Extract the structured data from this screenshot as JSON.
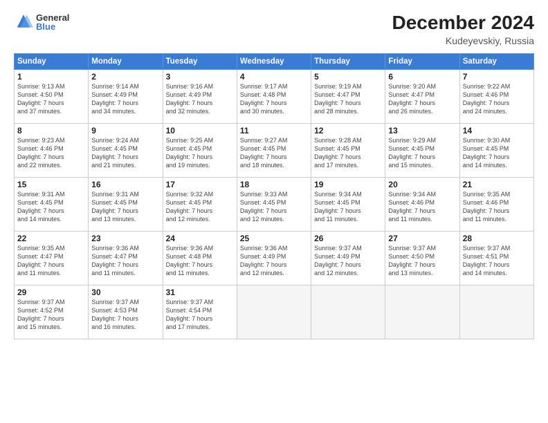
{
  "logo": {
    "general": "General",
    "blue": "Blue"
  },
  "title": "December 2024",
  "subtitle": "Kudeyevskiy, Russia",
  "headers": [
    "Sunday",
    "Monday",
    "Tuesday",
    "Wednesday",
    "Thursday",
    "Friday",
    "Saturday"
  ],
  "weeks": [
    [
      {
        "day": "1",
        "info": "Sunrise: 9:13 AM\nSunset: 4:50 PM\nDaylight: 7 hours\nand 37 minutes."
      },
      {
        "day": "2",
        "info": "Sunrise: 9:14 AM\nSunset: 4:49 PM\nDaylight: 7 hours\nand 34 minutes."
      },
      {
        "day": "3",
        "info": "Sunrise: 9:16 AM\nSunset: 4:49 PM\nDaylight: 7 hours\nand 32 minutes."
      },
      {
        "day": "4",
        "info": "Sunrise: 9:17 AM\nSunset: 4:48 PM\nDaylight: 7 hours\nand 30 minutes."
      },
      {
        "day": "5",
        "info": "Sunrise: 9:19 AM\nSunset: 4:47 PM\nDaylight: 7 hours\nand 28 minutes."
      },
      {
        "day": "6",
        "info": "Sunrise: 9:20 AM\nSunset: 4:47 PM\nDaylight: 7 hours\nand 26 minutes."
      },
      {
        "day": "7",
        "info": "Sunrise: 9:22 AM\nSunset: 4:46 PM\nDaylight: 7 hours\nand 24 minutes."
      }
    ],
    [
      {
        "day": "8",
        "info": "Sunrise: 9:23 AM\nSunset: 4:46 PM\nDaylight: 7 hours\nand 22 minutes."
      },
      {
        "day": "9",
        "info": "Sunrise: 9:24 AM\nSunset: 4:45 PM\nDaylight: 7 hours\nand 21 minutes."
      },
      {
        "day": "10",
        "info": "Sunrise: 9:25 AM\nSunset: 4:45 PM\nDaylight: 7 hours\nand 19 minutes."
      },
      {
        "day": "11",
        "info": "Sunrise: 9:27 AM\nSunset: 4:45 PM\nDaylight: 7 hours\nand 18 minutes."
      },
      {
        "day": "12",
        "info": "Sunrise: 9:28 AM\nSunset: 4:45 PM\nDaylight: 7 hours\nand 17 minutes."
      },
      {
        "day": "13",
        "info": "Sunrise: 9:29 AM\nSunset: 4:45 PM\nDaylight: 7 hours\nand 15 minutes."
      },
      {
        "day": "14",
        "info": "Sunrise: 9:30 AM\nSunset: 4:45 PM\nDaylight: 7 hours\nand 14 minutes."
      }
    ],
    [
      {
        "day": "15",
        "info": "Sunrise: 9:31 AM\nSunset: 4:45 PM\nDaylight: 7 hours\nand 14 minutes."
      },
      {
        "day": "16",
        "info": "Sunrise: 9:31 AM\nSunset: 4:45 PM\nDaylight: 7 hours\nand 13 minutes."
      },
      {
        "day": "17",
        "info": "Sunrise: 9:32 AM\nSunset: 4:45 PM\nDaylight: 7 hours\nand 12 minutes."
      },
      {
        "day": "18",
        "info": "Sunrise: 9:33 AM\nSunset: 4:45 PM\nDaylight: 7 hours\nand 12 minutes."
      },
      {
        "day": "19",
        "info": "Sunrise: 9:34 AM\nSunset: 4:45 PM\nDaylight: 7 hours\nand 11 minutes."
      },
      {
        "day": "20",
        "info": "Sunrise: 9:34 AM\nSunset: 4:46 PM\nDaylight: 7 hours\nand 11 minutes."
      },
      {
        "day": "21",
        "info": "Sunrise: 9:35 AM\nSunset: 4:46 PM\nDaylight: 7 hours\nand 11 minutes."
      }
    ],
    [
      {
        "day": "22",
        "info": "Sunrise: 9:35 AM\nSunset: 4:47 PM\nDaylight: 7 hours\nand 11 minutes."
      },
      {
        "day": "23",
        "info": "Sunrise: 9:36 AM\nSunset: 4:47 PM\nDaylight: 7 hours\nand 11 minutes."
      },
      {
        "day": "24",
        "info": "Sunrise: 9:36 AM\nSunset: 4:48 PM\nDaylight: 7 hours\nand 11 minutes."
      },
      {
        "day": "25",
        "info": "Sunrise: 9:36 AM\nSunset: 4:49 PM\nDaylight: 7 hours\nand 12 minutes."
      },
      {
        "day": "26",
        "info": "Sunrise: 9:37 AM\nSunset: 4:49 PM\nDaylight: 7 hours\nand 12 minutes."
      },
      {
        "day": "27",
        "info": "Sunrise: 9:37 AM\nSunset: 4:50 PM\nDaylight: 7 hours\nand 13 minutes."
      },
      {
        "day": "28",
        "info": "Sunrise: 9:37 AM\nSunset: 4:51 PM\nDaylight: 7 hours\nand 14 minutes."
      }
    ],
    [
      {
        "day": "29",
        "info": "Sunrise: 9:37 AM\nSunset: 4:52 PM\nDaylight: 7 hours\nand 15 minutes."
      },
      {
        "day": "30",
        "info": "Sunrise: 9:37 AM\nSunset: 4:53 PM\nDaylight: 7 hours\nand 16 minutes."
      },
      {
        "day": "31",
        "info": "Sunrise: 9:37 AM\nSunset: 4:54 PM\nDaylight: 7 hours\nand 17 minutes."
      },
      {
        "day": "",
        "info": ""
      },
      {
        "day": "",
        "info": ""
      },
      {
        "day": "",
        "info": ""
      },
      {
        "day": "",
        "info": ""
      }
    ]
  ]
}
